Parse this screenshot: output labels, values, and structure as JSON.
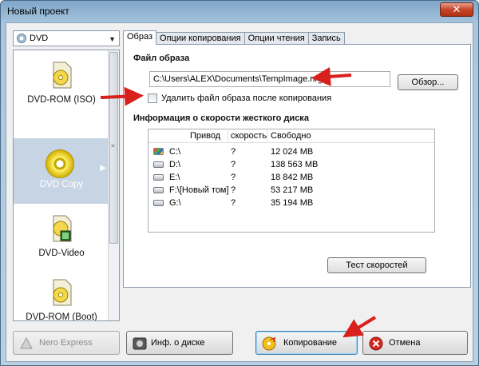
{
  "window": {
    "title": "Новый проект",
    "close_glyph": "✕"
  },
  "disc_type": {
    "selected": "DVD",
    "arrow": "▼"
  },
  "nav": {
    "items": [
      {
        "label": "DVD-ROM (ISO)"
      },
      {
        "label": "DVD Copy"
      },
      {
        "label": "DVD-Video"
      },
      {
        "label": "DVD-ROM (Boot)"
      }
    ],
    "selected_arrow": "▶",
    "scroll_grip": "≡"
  },
  "tabs": [
    "Образ",
    "Опции копирования",
    "Опции чтения",
    "Запись"
  ],
  "image_file": {
    "section_title": "Файл образа",
    "path": "C:\\Users\\ALEX\\Documents\\TempImage.nrg",
    "browse_label": "Обзор...",
    "delete_checkbox_label": "Удалить файл образа после копирования",
    "delete_checked": false
  },
  "disk_speed": {
    "section_title": "Информация о скорости жесткого диска",
    "columns": {
      "drive": "Привод",
      "speed": "скорость",
      "free": "Свободно"
    },
    "rows": [
      {
        "drive": "C:\\",
        "speed": "?",
        "free": "12 024 MB",
        "icon": "system-drive-icon"
      },
      {
        "drive": "D:\\",
        "speed": "?",
        "free": "138 563 MB",
        "icon": "hard-drive-icon"
      },
      {
        "drive": "E:\\",
        "speed": "?",
        "free": "18 842 MB",
        "icon": "hard-drive-icon"
      },
      {
        "drive": "F:\\[Новый том]",
        "speed": "?",
        "free": "53 217 MB",
        "icon": "hard-drive-icon"
      },
      {
        "drive": "G:\\",
        "speed": "?",
        "free": "35 194 MB",
        "icon": "hard-drive-icon"
      }
    ],
    "test_button_label": "Тест скоростей"
  },
  "bottom_buttons": {
    "nero_express": "Nero Express",
    "disc_info": "Инф. о диске",
    "copy": "Копирование",
    "cancel": "Отмена"
  },
  "colors": {
    "annotation_arrow": "#d8201c",
    "selected_item": "#c6d4e4"
  }
}
